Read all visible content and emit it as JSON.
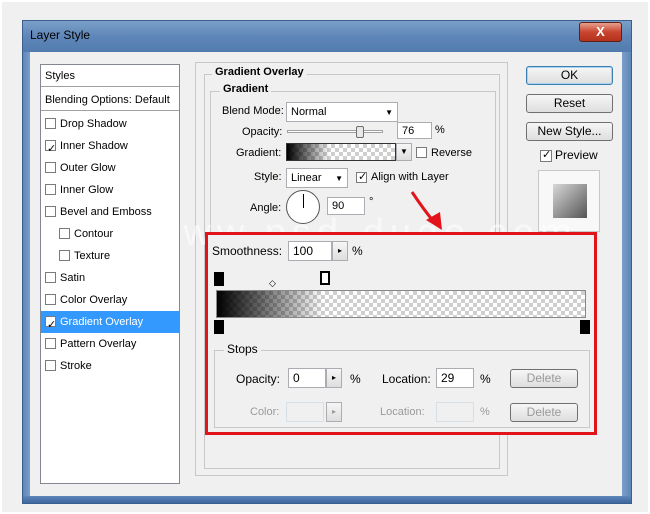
{
  "window": {
    "title": "Layer Style",
    "close": "X"
  },
  "styles_list": {
    "header": "Styles",
    "blending": "Blending Options: Default",
    "items": [
      {
        "label": "Drop Shadow",
        "checked": false
      },
      {
        "label": "Inner Shadow",
        "checked": true
      },
      {
        "label": "Outer Glow",
        "checked": false
      },
      {
        "label": "Inner Glow",
        "checked": false
      },
      {
        "label": "Bevel and Emboss",
        "checked": false
      },
      {
        "label": "Contour",
        "checked": false
      },
      {
        "label": "Texture",
        "checked": false
      },
      {
        "label": "Satin",
        "checked": false
      },
      {
        "label": "Color Overlay",
        "checked": false
      },
      {
        "label": "Gradient Overlay",
        "checked": true
      },
      {
        "label": "Pattern Overlay",
        "checked": false
      },
      {
        "label": "Stroke",
        "checked": false
      }
    ]
  },
  "buttons": {
    "ok": "OK",
    "reset": "Reset",
    "new_style": "New Style...",
    "preview": "Preview"
  },
  "gradient_overlay": {
    "section_title": "Gradient Overlay",
    "group_title": "Gradient",
    "blend_mode_label": "Blend Mode:",
    "blend_mode_value": "Normal",
    "opacity_label": "Opacity:",
    "opacity_value": "76",
    "opacity_unit": "%",
    "opacity_level": 0.76,
    "gradient_label": "Gradient:",
    "reverse_label": "Reverse",
    "style_label": "Style:",
    "style_value": "Linear",
    "align_label": "Align with Layer",
    "angle_label": "Angle:",
    "angle_value": "90",
    "angle_unit": "°"
  },
  "editor": {
    "smoothness_label": "Smoothness:",
    "smoothness_value": "100",
    "smoothness_unit": "%",
    "stops_title": "Stops",
    "opacity_label": "Opacity:",
    "opacity_value": "0",
    "opacity_unit": "%",
    "location_label": "Location:",
    "location_value": "29",
    "location_unit": "%",
    "delete_label": "Delete",
    "color_label": "Color:",
    "color_location_label": "Location:",
    "color_location_unit": "%",
    "color_delete_label": "Delete"
  },
  "watermark": "www.psd-dude.com",
  "colors": {
    "highlight": "#e2131b",
    "selected": "#3399ff"
  }
}
